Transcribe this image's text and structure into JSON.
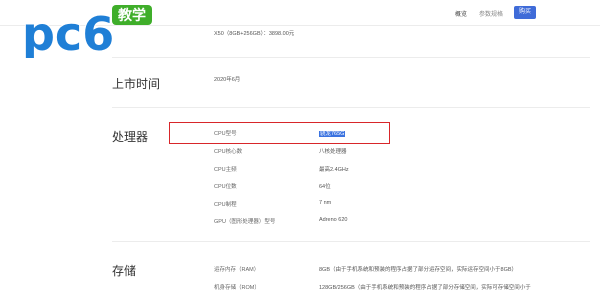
{
  "nav": {
    "overview": "概览",
    "specs": "参数规格",
    "buy": "购买"
  },
  "logo": {
    "brand": "pc6",
    "tag": "教学"
  },
  "top_value": "X50（8GB+256GB）：3898.00元",
  "release": {
    "title": "上市时间",
    "value": "2020年6月"
  },
  "processor": {
    "title": "处理器",
    "rows": [
      {
        "label": "CPU型号",
        "value": "骁龙765G"
      },
      {
        "label": "CPU核心数",
        "value": "八核处理器"
      },
      {
        "label": "CPU主频",
        "value": "最高2.4GHz"
      },
      {
        "label": "CPU位数",
        "value": "64位"
      },
      {
        "label": "CPU制程",
        "value": "7 nm"
      },
      {
        "label": "GPU（图形处理器）型号",
        "value": "Adreno 620"
      }
    ]
  },
  "storage": {
    "title": "存储",
    "rows": [
      {
        "label": "运存内存（RAM）",
        "value": "8GB（由于手机系统和预装的程序占据了部分运存空间，实际运存空间小于8GB）"
      },
      {
        "label": "机身存储（ROM）",
        "value": "128GB/256GB（由于手机系统和预装的程序占据了部分存储空间，实际可存储空间小于"
      }
    ]
  },
  "colors": {
    "highlight_border": "#d8262a",
    "selection": "#3b73e0",
    "buy_button": "#3f6bd8",
    "logo_blue": "#1f7fd6",
    "logo_green": "#3fae2a"
  }
}
